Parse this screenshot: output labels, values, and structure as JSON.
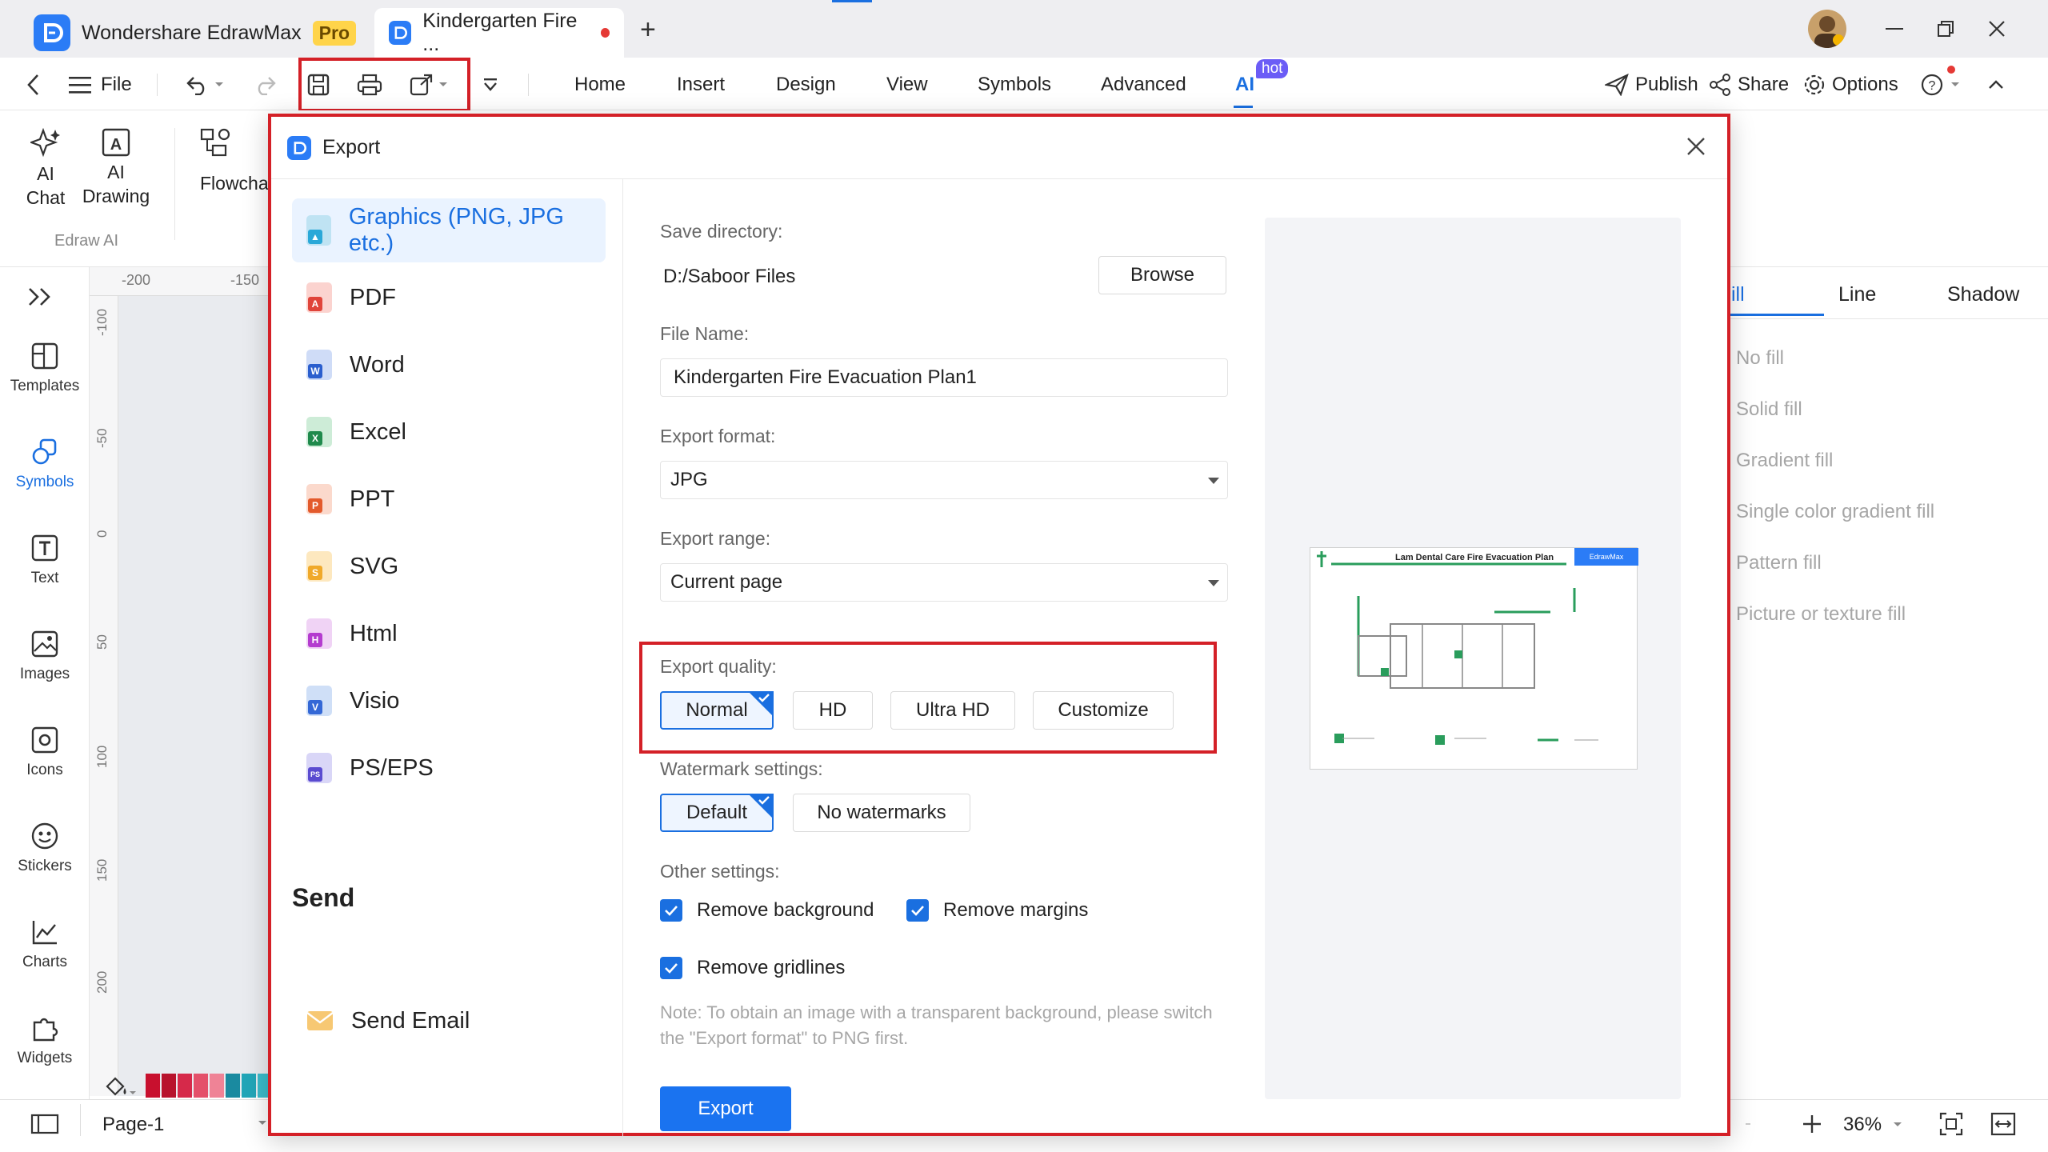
{
  "titlebar": {
    "app_name": "Wondershare EdrawMax",
    "pro_badge": "Pro",
    "doc_tab": "Kindergarten Fire ...",
    "new_tab": "+"
  },
  "toolbar": {
    "file": "File",
    "menus": [
      "Home",
      "Insert",
      "Design",
      "View",
      "Symbols",
      "Advanced",
      "AI"
    ],
    "hot_badge": "hot",
    "publish": "Publish",
    "share": "Share",
    "options": "Options"
  },
  "ribbon": {
    "ai_chat": [
      "AI",
      "Chat"
    ],
    "ai_drawing": [
      "AI",
      "Drawing"
    ],
    "flowchart": "Flowcha",
    "group_label": "Edraw AI"
  },
  "leftbar": [
    "Templates",
    "Symbols",
    "Text",
    "Images",
    "Icons",
    "Stickers",
    "Charts",
    "Widgets"
  ],
  "ruler": {
    "top": [
      "-200",
      "-150"
    ],
    "left": [
      "-100",
      "-50",
      "0",
      "50",
      "100",
      "150",
      "200"
    ]
  },
  "rightpanel": {
    "tabs": [
      "ill",
      "Line",
      "Shadow"
    ],
    "fills": [
      "No fill",
      "Solid fill",
      "Gradient fill",
      "Single color gradient fill",
      "Pattern fill",
      "Picture or texture fill"
    ]
  },
  "bottombar": {
    "page": "Page-1",
    "zoom": "36%"
  },
  "dialog": {
    "title": "Export",
    "nav": [
      "Graphics (PNG, JPG etc.)",
      "PDF",
      "Word",
      "Excel",
      "PPT",
      "SVG",
      "Html",
      "Visio",
      "PS/EPS"
    ],
    "send_heading": "Send",
    "send_email": "Send Email",
    "save_dir_label": "Save directory:",
    "save_dir_value": "D:/Saboor Files",
    "browse": "Browse",
    "file_name_label": "File Name:",
    "file_name_value": "Kindergarten Fire Evacuation Plan1",
    "format_label": "Export format:",
    "format_value": "JPG",
    "range_label": "Export range:",
    "range_value": "Current page",
    "quality_label": "Export quality:",
    "quality_options": [
      "Normal",
      "HD",
      "Ultra HD",
      "Customize"
    ],
    "watermark_label": "Watermark settings:",
    "watermark_options": [
      "Default",
      "No watermarks"
    ],
    "other_label": "Other settings:",
    "remove_background": "Remove background",
    "remove_margins": "Remove margins",
    "remove_gridlines": "Remove gridlines",
    "note": "Note: To obtain an image with a transparent background, please switch the \"Export format\" to PNG first.",
    "export_button": "Export",
    "preview_title": "Lam Dental Care Fire Evacuation Plan",
    "preview_brand": "EdrawMax"
  },
  "colors": {
    "accent": "#1a6fe0",
    "highlight": "#d42027",
    "brand": "#2b7cf6"
  }
}
